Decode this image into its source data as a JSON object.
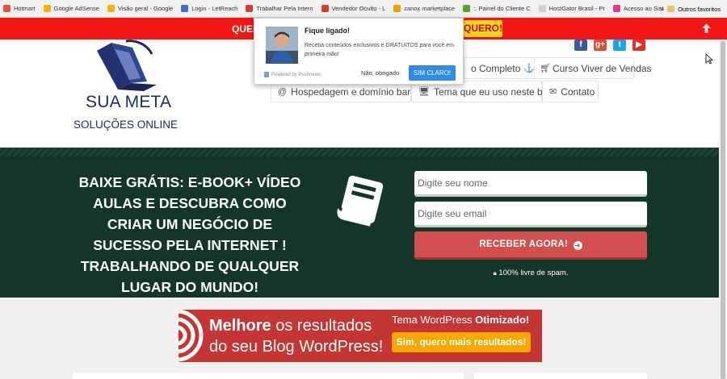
{
  "bookmarks": {
    "items": [
      {
        "label": "Hotmart",
        "color": "#e8533a"
      },
      {
        "label": "Google AdSense",
        "color": "#f2b20b"
      },
      {
        "label": "Visão geral - Google",
        "color": "#f2b20b"
      },
      {
        "label": "Login - LetReach",
        "color": "#3b6fc9"
      },
      {
        "label": "Trabalhar Pela Intern",
        "color": "#d93a2a"
      },
      {
        "label": "Vendedor Oculto - L",
        "color": "#d93a2a"
      },
      {
        "label": "zanox marketplace",
        "color": "#f0a000"
      },
      {
        "label": ":. Painel do Cliente C",
        "color": "#5aa33a"
      },
      {
        "label": "HostGator Brasil - Pr",
        "color": "#d0d0d0"
      },
      {
        "label": "Acesso ao Sistema -",
        "color": "#e6398a"
      }
    ],
    "more": "»",
    "other": "Outros favoritos"
  },
  "redbar": {
    "text": "QUER",
    "button": "QUERO!"
  },
  "popup": {
    "title": "Fique ligado!",
    "body": "Receba conteúdos exclusivos e GRATUITOS para você em primeira mão!",
    "powered": "Powered by Pushnews",
    "decline": "Não, obrigado",
    "accept": "SIM CLARO!"
  },
  "header": {
    "logo_title": "SUA META",
    "logo_subtitle": "SOLUÇÕES ONLINE",
    "social": [
      {
        "name": "facebook-icon",
        "glyph": "f",
        "color": "#3b5998"
      },
      {
        "name": "google-plus-icon",
        "glyph": "g+",
        "color": "#dd4b39"
      },
      {
        "name": "twitter-icon",
        "glyph": "t",
        "color": "#1da1f2"
      },
      {
        "name": "youtube-icon",
        "glyph": "▶",
        "color": "#e52d27"
      }
    ],
    "nav": {
      "curso_completo": "o Completo",
      "curso_vendas": "Curso Viver de Vendas",
      "hospedagem": "Hospedagem e domínio barato",
      "tema": "Tema que eu uso neste blog",
      "contato": "Contato"
    }
  },
  "hero": {
    "title": "BAIXE GRÁTIS: E-BOOK+ VÍDEO AULAS E DESCUBRA COMO CRIAR UM NEGÓCIO DE SUCESSO PELA INTERNET ! TRABALHANDO DE QUALQUER LUGAR DO MUNDO!",
    "name_placeholder": "Digite seu nome",
    "email_placeholder": "Digite seu email",
    "cta": "RECEBER AGORA!",
    "spam": "100% livre de spam."
  },
  "banner": {
    "line1_bold": "Melhore",
    "line1_rest": " os resultados",
    "line2": "do seu Blog WordPress!",
    "right_title_plain": "Tema WordPress ",
    "right_title_bold": "Otimizado!",
    "button_bold": "Sim",
    "button_rest": ", quero mais resultados!"
  }
}
